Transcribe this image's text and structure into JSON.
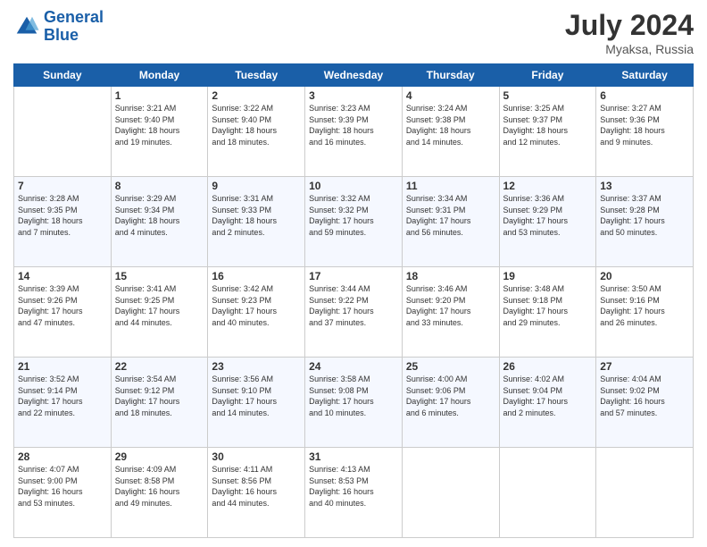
{
  "header": {
    "logo_line1": "General",
    "logo_line2": "Blue",
    "month_year": "July 2024",
    "location": "Myaksa, Russia"
  },
  "days_of_week": [
    "Sunday",
    "Monday",
    "Tuesday",
    "Wednesday",
    "Thursday",
    "Friday",
    "Saturday"
  ],
  "weeks": [
    [
      {
        "day": "",
        "content": ""
      },
      {
        "day": "1",
        "content": "Sunrise: 3:21 AM\nSunset: 9:40 PM\nDaylight: 18 hours\nand 19 minutes."
      },
      {
        "day": "2",
        "content": "Sunrise: 3:22 AM\nSunset: 9:40 PM\nDaylight: 18 hours\nand 18 minutes."
      },
      {
        "day": "3",
        "content": "Sunrise: 3:23 AM\nSunset: 9:39 PM\nDaylight: 18 hours\nand 16 minutes."
      },
      {
        "day": "4",
        "content": "Sunrise: 3:24 AM\nSunset: 9:38 PM\nDaylight: 18 hours\nand 14 minutes."
      },
      {
        "day": "5",
        "content": "Sunrise: 3:25 AM\nSunset: 9:37 PM\nDaylight: 18 hours\nand 12 minutes."
      },
      {
        "day": "6",
        "content": "Sunrise: 3:27 AM\nSunset: 9:36 PM\nDaylight: 18 hours\nand 9 minutes."
      }
    ],
    [
      {
        "day": "7",
        "content": "Sunrise: 3:28 AM\nSunset: 9:35 PM\nDaylight: 18 hours\nand 7 minutes."
      },
      {
        "day": "8",
        "content": "Sunrise: 3:29 AM\nSunset: 9:34 PM\nDaylight: 18 hours\nand 4 minutes."
      },
      {
        "day": "9",
        "content": "Sunrise: 3:31 AM\nSunset: 9:33 PM\nDaylight: 18 hours\nand 2 minutes."
      },
      {
        "day": "10",
        "content": "Sunrise: 3:32 AM\nSunset: 9:32 PM\nDaylight: 17 hours\nand 59 minutes."
      },
      {
        "day": "11",
        "content": "Sunrise: 3:34 AM\nSunset: 9:31 PM\nDaylight: 17 hours\nand 56 minutes."
      },
      {
        "day": "12",
        "content": "Sunrise: 3:36 AM\nSunset: 9:29 PM\nDaylight: 17 hours\nand 53 minutes."
      },
      {
        "day": "13",
        "content": "Sunrise: 3:37 AM\nSunset: 9:28 PM\nDaylight: 17 hours\nand 50 minutes."
      }
    ],
    [
      {
        "day": "14",
        "content": "Sunrise: 3:39 AM\nSunset: 9:26 PM\nDaylight: 17 hours\nand 47 minutes."
      },
      {
        "day": "15",
        "content": "Sunrise: 3:41 AM\nSunset: 9:25 PM\nDaylight: 17 hours\nand 44 minutes."
      },
      {
        "day": "16",
        "content": "Sunrise: 3:42 AM\nSunset: 9:23 PM\nDaylight: 17 hours\nand 40 minutes."
      },
      {
        "day": "17",
        "content": "Sunrise: 3:44 AM\nSunset: 9:22 PM\nDaylight: 17 hours\nand 37 minutes."
      },
      {
        "day": "18",
        "content": "Sunrise: 3:46 AM\nSunset: 9:20 PM\nDaylight: 17 hours\nand 33 minutes."
      },
      {
        "day": "19",
        "content": "Sunrise: 3:48 AM\nSunset: 9:18 PM\nDaylight: 17 hours\nand 29 minutes."
      },
      {
        "day": "20",
        "content": "Sunrise: 3:50 AM\nSunset: 9:16 PM\nDaylight: 17 hours\nand 26 minutes."
      }
    ],
    [
      {
        "day": "21",
        "content": "Sunrise: 3:52 AM\nSunset: 9:14 PM\nDaylight: 17 hours\nand 22 minutes."
      },
      {
        "day": "22",
        "content": "Sunrise: 3:54 AM\nSunset: 9:12 PM\nDaylight: 17 hours\nand 18 minutes."
      },
      {
        "day": "23",
        "content": "Sunrise: 3:56 AM\nSunset: 9:10 PM\nDaylight: 17 hours\nand 14 minutes."
      },
      {
        "day": "24",
        "content": "Sunrise: 3:58 AM\nSunset: 9:08 PM\nDaylight: 17 hours\nand 10 minutes."
      },
      {
        "day": "25",
        "content": "Sunrise: 4:00 AM\nSunset: 9:06 PM\nDaylight: 17 hours\nand 6 minutes."
      },
      {
        "day": "26",
        "content": "Sunrise: 4:02 AM\nSunset: 9:04 PM\nDaylight: 17 hours\nand 2 minutes."
      },
      {
        "day": "27",
        "content": "Sunrise: 4:04 AM\nSunset: 9:02 PM\nDaylight: 16 hours\nand 57 minutes."
      }
    ],
    [
      {
        "day": "28",
        "content": "Sunrise: 4:07 AM\nSunset: 9:00 PM\nDaylight: 16 hours\nand 53 minutes."
      },
      {
        "day": "29",
        "content": "Sunrise: 4:09 AM\nSunset: 8:58 PM\nDaylight: 16 hours\nand 49 minutes."
      },
      {
        "day": "30",
        "content": "Sunrise: 4:11 AM\nSunset: 8:56 PM\nDaylight: 16 hours\nand 44 minutes."
      },
      {
        "day": "31",
        "content": "Sunrise: 4:13 AM\nSunset: 8:53 PM\nDaylight: 16 hours\nand 40 minutes."
      },
      {
        "day": "",
        "content": ""
      },
      {
        "day": "",
        "content": ""
      },
      {
        "day": "",
        "content": ""
      }
    ]
  ]
}
